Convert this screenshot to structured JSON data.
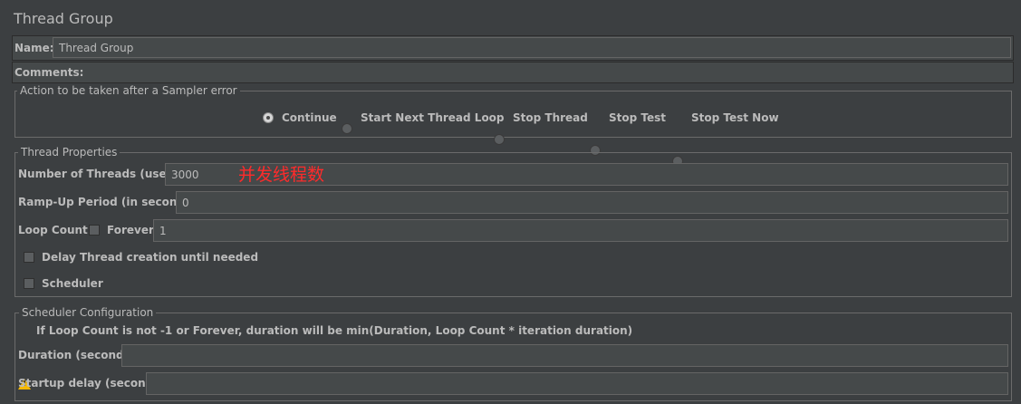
{
  "panel": {
    "title": "Thread Group",
    "name_label": "Name:",
    "name_value": "Thread Group",
    "comments_label": "Comments:"
  },
  "sampler_error": {
    "legend": "Action to be taken after a Sampler error",
    "options": [
      "Continue",
      "Start Next Thread Loop",
      "Stop Thread",
      "Stop Test",
      "Stop Test Now"
    ],
    "selected": "Continue"
  },
  "thread_properties": {
    "legend": "Thread Properties",
    "threads_label": "Number of Threads (users):",
    "threads_value": "3000",
    "annotation": "并发线程数",
    "rampup_label": "Ramp-Up Period (in seconds):",
    "rampup_value": "0",
    "loop_label": "Loop Count:",
    "forever_label": "Forever",
    "loop_value": "1",
    "delay_label": "Delay Thread creation until needed",
    "scheduler_label": "Scheduler"
  },
  "scheduler_config": {
    "legend": "Scheduler Configuration",
    "warning": "If Loop Count is not -1 or Forever, duration will be min(Duration, Loop Count * iteration duration)",
    "duration_label": "Duration (seconds)",
    "startup_label": "Startup delay (seconds)"
  },
  "icons": {
    "warning": "warning-icon"
  },
  "colors": {
    "background": "#3c3f41",
    "field": "#45494a",
    "text": "#bbbbbb",
    "annotation": "#ff2b2b",
    "warning": "#f5b800"
  }
}
